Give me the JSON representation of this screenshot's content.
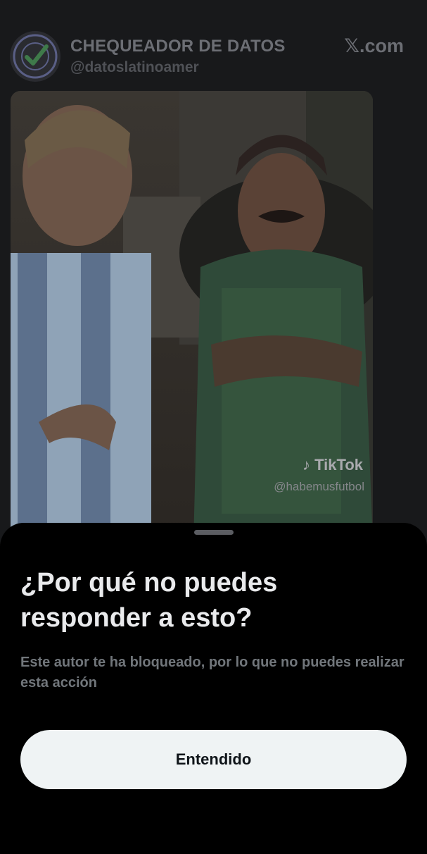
{
  "tweet": {
    "author_name": "CHEQUEADOR DE DATOS",
    "author_handle": "@datoslatinoamer",
    "brand": "𝕏.com",
    "avatar_badge_text": "CHECKED",
    "media": {
      "watermark_platform": "TikTok",
      "watermark_handle": "@habemusfutbol"
    }
  },
  "sheet": {
    "title": "¿Por qué no puedes responder a esto?",
    "body": "Este autor te ha bloqueado, por lo que no puedes realizar esta acción",
    "primary_button": "Entendido"
  },
  "colors": {
    "sheet_background": "#000000",
    "button_background": "#eff3f4",
    "title_text": "#e9eaec",
    "body_text": "#71767b"
  }
}
